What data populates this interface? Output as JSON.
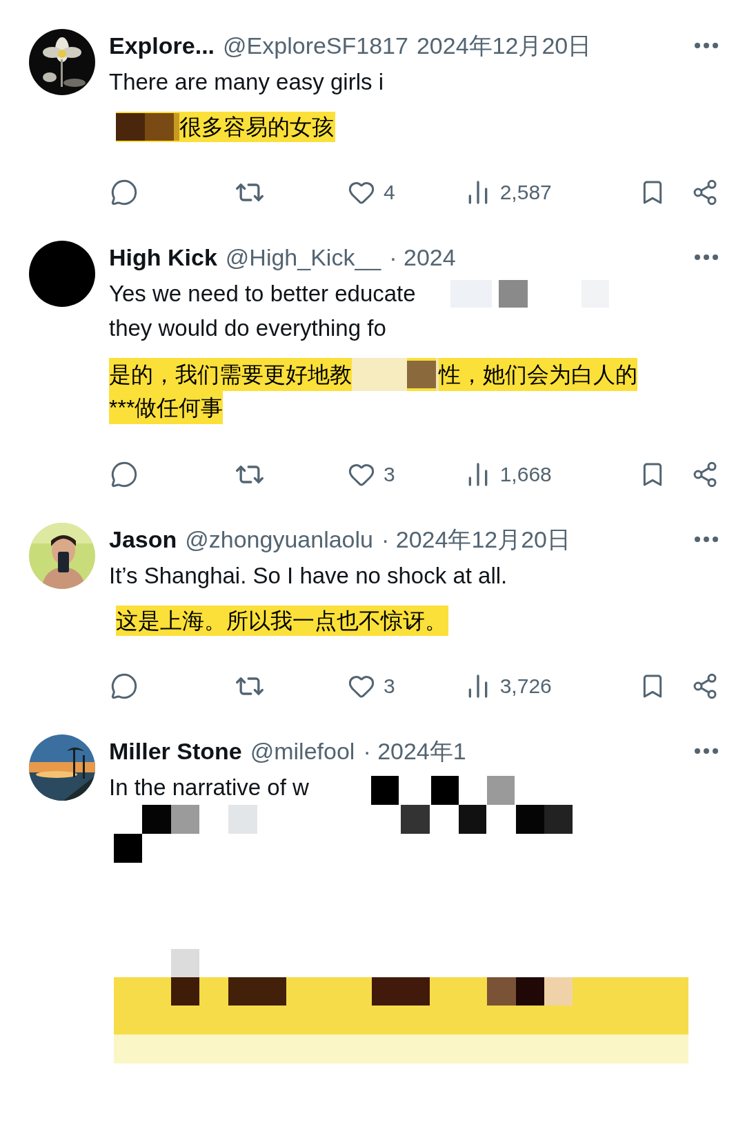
{
  "posts": [
    {
      "avatar": {
        "kind": "picture"
      },
      "name": "Explore...",
      "handle": "@ExploreSF1817",
      "date": "2024年12月20日",
      "text": [
        "There are many easy girls i"
      ],
      "translation": [
        "很多容易的女孩"
      ],
      "mosaic": {
        "kind": "prefix"
      },
      "stats": {
        "likes": "4",
        "views": "2,587"
      }
    },
    {
      "avatar": {
        "kind": "plain"
      },
      "name": "High Kick",
      "handle": "@High_Kick__",
      "date": "· 2024",
      "text": [
        "Yes we need to better educate",
        "they would do everything fo"
      ],
      "translation": [
        "是的，我们需要更好地教",
        "性，她们会为白人的",
        "***做任何事"
      ],
      "mosaic": {
        "kind": "middle"
      },
      "stats": {
        "likes": "3",
        "views": "1,668"
      }
    },
    {
      "avatar": {
        "kind": "figure"
      },
      "name": "Jason",
      "handle": "@zhongyuanlaolu",
      "date": "· 2024年12月20日",
      "text": [
        "It’s Shanghai. So I have no shock at all."
      ],
      "translation": [
        "这是上海。所以我一点也不惊讶。"
      ],
      "stats": {
        "likes": "3",
        "views": "3,726"
      }
    },
    {
      "avatar": {
        "kind": "beach"
      },
      "name": "Miller Stone",
      "handle": "@milefool",
      "date": "· 2024年1",
      "text": [
        "In the narrative of w"
      ],
      "mosaic": {
        "kind": "full"
      }
    }
  ]
}
